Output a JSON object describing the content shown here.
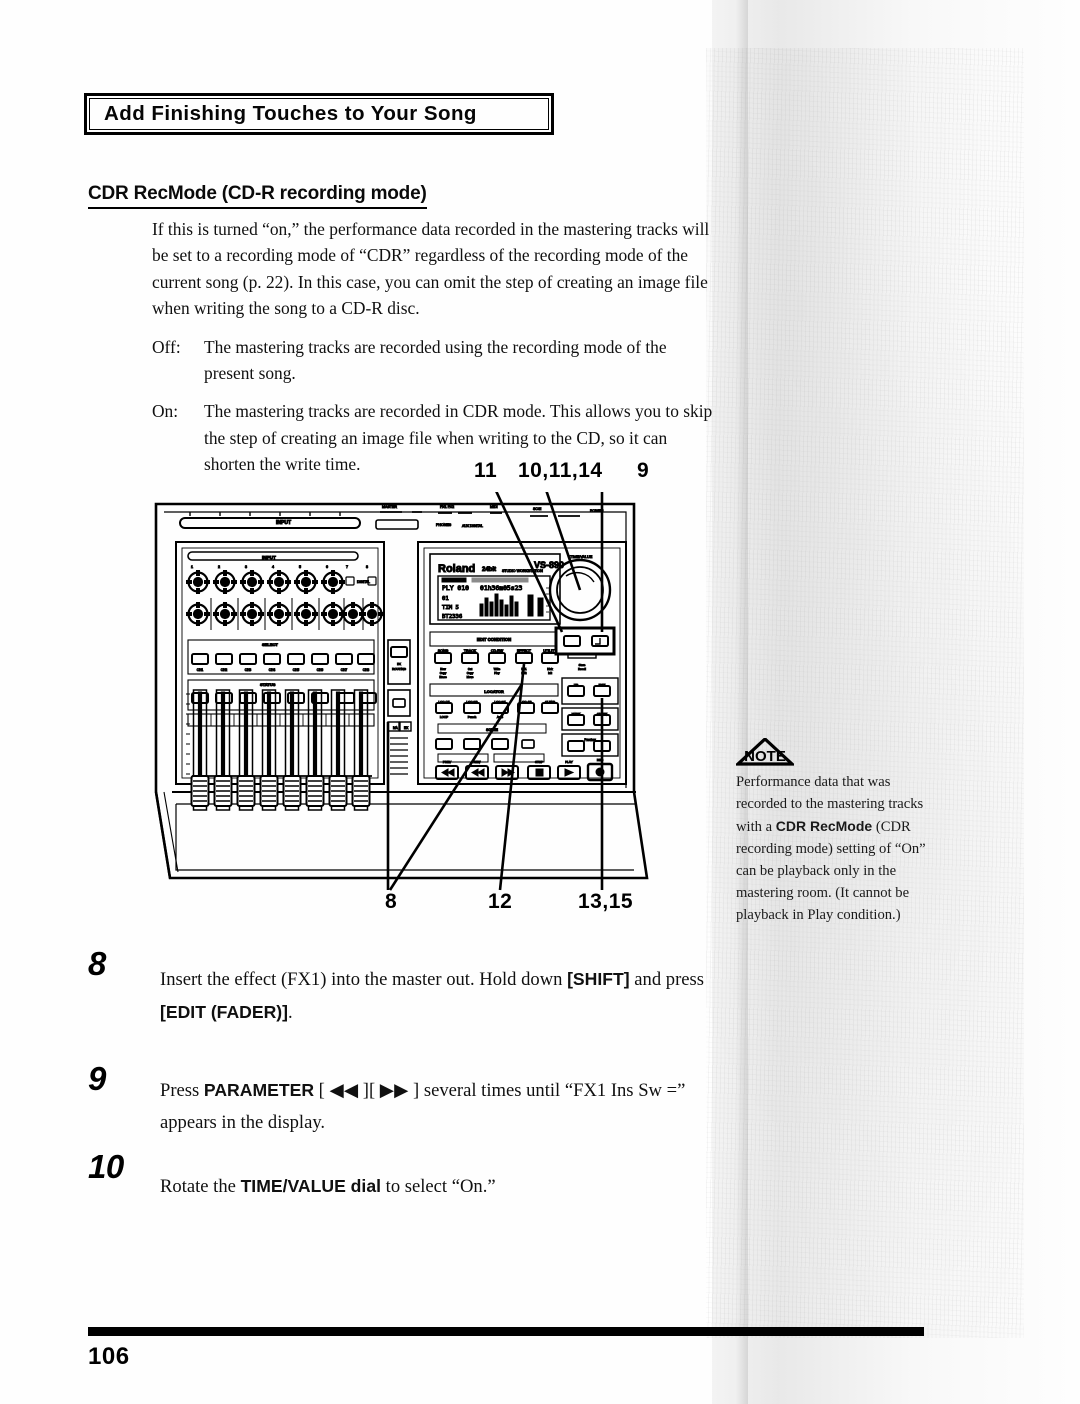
{
  "header": {
    "chapter_banner": "Add Finishing Touches to Your Song",
    "section_heading": "CDR RecMode (CD-R recording mode)"
  },
  "body": {
    "intro": "If this is turned “on,” the performance data recorded in the mastering tracks will be set to a recording mode of “CDR” regardless of the recording mode of the current song (p. 22). In this case, you can omit the step of creating an image file when writing the song to a CD-R disc.",
    "definitions": [
      {
        "term": "Off:",
        "text": "The mastering tracks are recorded using the recording mode of the present song."
      },
      {
        "term": "On:",
        "text": "The mastering tracks are recorded in CDR mode. This allows you to skip the step of creating an image file when writing to the CD, so it can shorten the write time."
      }
    ]
  },
  "figure": {
    "device_brand": "Roland",
    "device_model": "VS-890",
    "lcd_line_1": "PLY 010     01h36m05s23",
    "lcd_line_2": "01",
    "lcd_line_3": "TIM        5",
    "lcd_line_4": "BT2336",
    "callouts_top": [
      {
        "id": "callout-11",
        "label": "11"
      },
      {
        "id": "callout-10-11-14",
        "label": "10,11,14"
      },
      {
        "id": "callout-9",
        "label": "9"
      }
    ],
    "callouts_bottom": [
      {
        "id": "callout-8",
        "label": "8"
      },
      {
        "id": "callout-12",
        "label": "12"
      },
      {
        "id": "callout-13-15",
        "label": "13,15"
      }
    ],
    "panel_labels": {
      "input": "INPUT",
      "select": "SELECT",
      "status": "STATUS",
      "edit_condition": "EDIT CONDITION",
      "locator": "LOCATOR",
      "scene": "SCENE",
      "time_value": "TIME/VALUE",
      "fader_numbers": [
        "1",
        "2",
        "3",
        "4",
        "5",
        "6",
        "7",
        "8"
      ]
    }
  },
  "note": {
    "badge_label": "NOTE",
    "text_before": "Performance data that was recorded to the mastering tracks with a ",
    "bold_term": "CDR RecMode",
    "text_after": " (CDR recording mode) setting of “On” can be playback only in the mastering room. (It cannot be playback in Play condition.)"
  },
  "steps": [
    {
      "number": "8",
      "parts": [
        {
          "t": "Insert the effect (FX1) into the master out. Hold down ",
          "b": false
        },
        {
          "t": "[SHIFT]",
          "b": true
        },
        {
          "t": " and press ",
          "b": false
        },
        {
          "t": "[EDIT (FADER)]",
          "b": true
        },
        {
          "t": ".",
          "b": false
        }
      ]
    },
    {
      "number": "9",
      "parts": [
        {
          "t": "Press ",
          "b": false
        },
        {
          "t": "PARAMETER",
          "b": true
        },
        {
          "t": " [ ◀◀ ][ ▶▶ ] several times until “FX1 Ins Sw =” appears in the display.",
          "b": false
        }
      ]
    },
    {
      "number": "10",
      "parts": [
        {
          "t": "Rotate the ",
          "b": false
        },
        {
          "t": "TIME/VALUE dial",
          "b": true
        },
        {
          "t": " to select “On.”",
          "b": false
        }
      ]
    }
  ],
  "footer": {
    "page_number": "106"
  },
  "colors": {
    "ink": "#0a0a0a",
    "paper": "#fefefe",
    "scan_shadow": "#8a8a8a"
  }
}
